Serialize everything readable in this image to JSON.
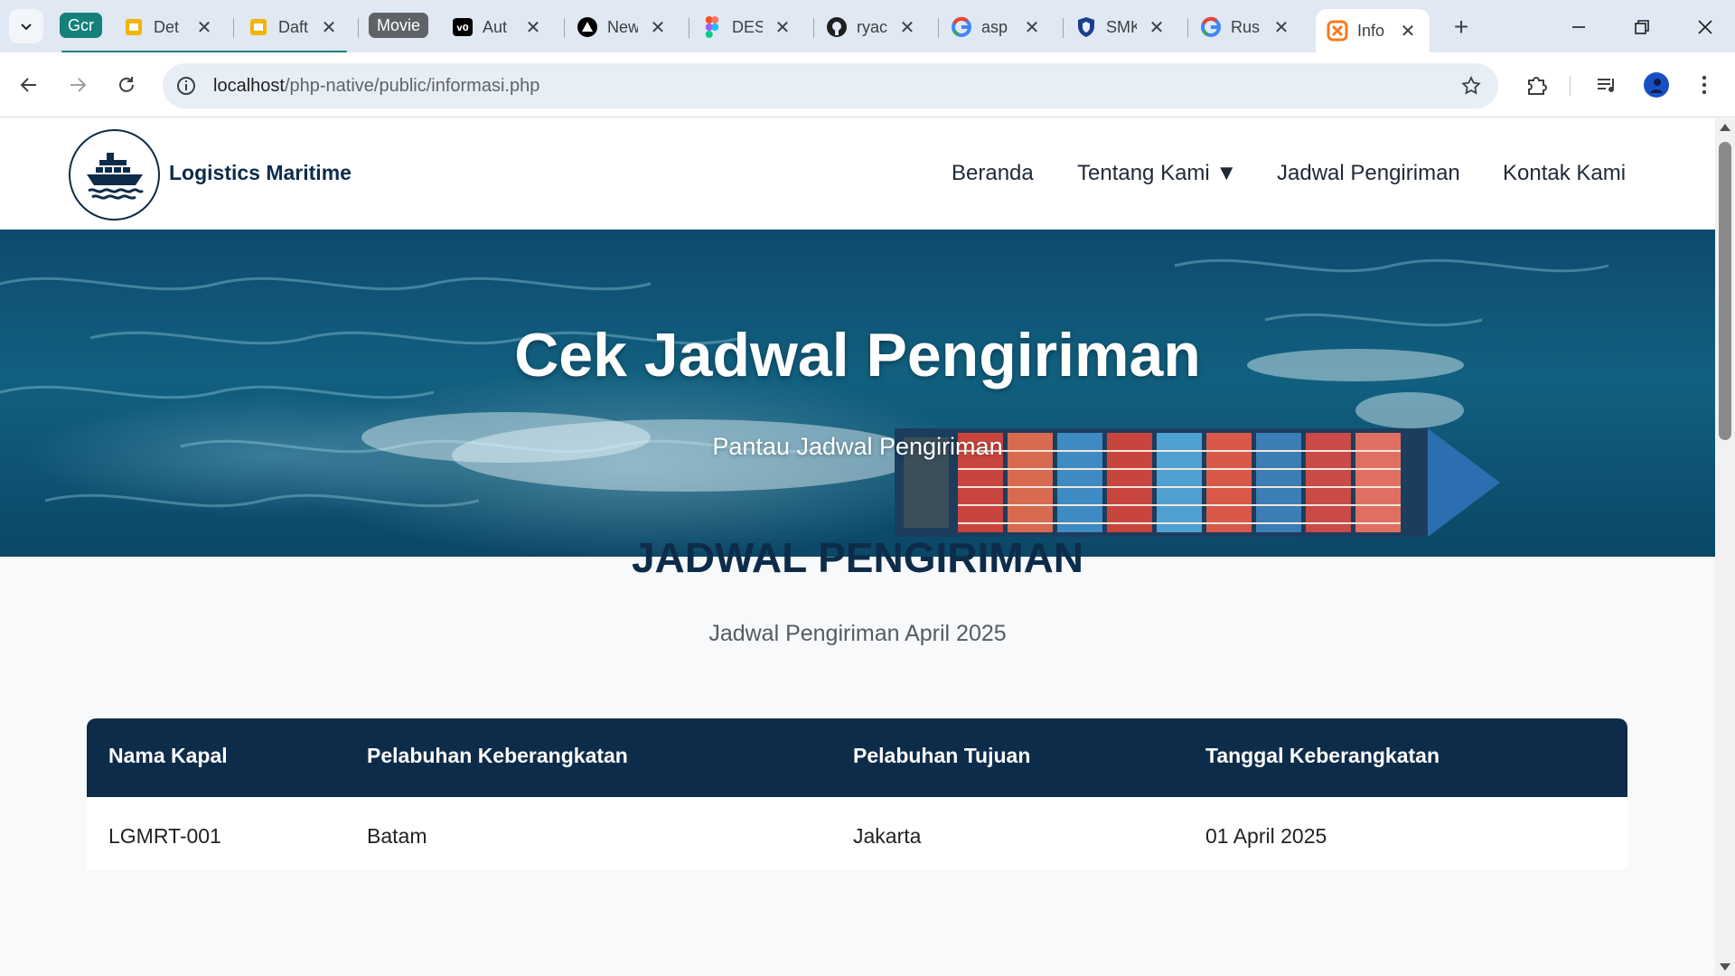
{
  "browser": {
    "tab_groups": [
      {
        "label": "Gcr",
        "color": "#14807a"
      },
      {
        "label": "Movie",
        "color": "#5f6368"
      }
    ],
    "tabs": [
      {
        "title": "Det",
        "icon": "google-slides-icon"
      },
      {
        "title": "Daft",
        "icon": "google-slides-icon"
      },
      {
        "title": "Aut",
        "icon": "v0-icon"
      },
      {
        "title": "New",
        "icon": "triangle-logo-icon"
      },
      {
        "title": "DES",
        "icon": "figma-icon"
      },
      {
        "title": "ryac",
        "icon": "github-icon"
      },
      {
        "title": "asp",
        "icon": "google-icon"
      },
      {
        "title": "SMK",
        "icon": "shield-crest-icon"
      },
      {
        "title": "Rus",
        "icon": "google-icon"
      },
      {
        "title": "Info",
        "icon": "xampp-icon"
      }
    ],
    "url_host": "localhost",
    "url_path": "/php-native/public/informasi.php"
  },
  "site": {
    "brand": "Logistics Maritime",
    "nav": {
      "home": "Beranda",
      "about": "Tentang Kami ▼",
      "schedule": "Jadwal Pengiriman",
      "contact": "Kontak Kami"
    },
    "hero": {
      "title": "Cek Jadwal Pengiriman",
      "subtitle": "Pantau Jadwal Pengiriman"
    },
    "section": {
      "title": "JADWAL PENGIRIMAN",
      "subtitle": "Jadwal Pengiriman April 2025"
    },
    "table": {
      "headers": [
        "Nama Kapal",
        "Pelabuhan Keberangkatan",
        "Pelabuhan Tujuan",
        "Tanggal Keberangkatan"
      ],
      "rows": [
        [
          "LGMRT-001",
          "Batam",
          "Jakarta",
          "01 April 2025"
        ]
      ]
    }
  },
  "colors": {
    "primary": "#0d2c4a",
    "page_bg": "#f7f9fb"
  }
}
